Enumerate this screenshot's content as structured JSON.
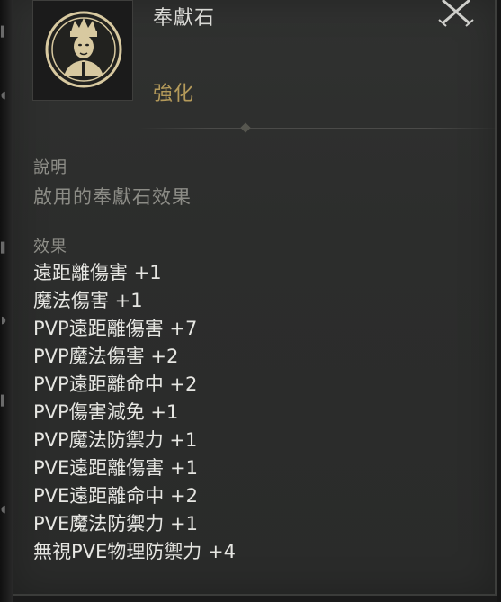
{
  "item": {
    "name": "奉獻石",
    "grade": "強化",
    "icon": "noble-portrait-medallion-icon"
  },
  "close_button": {
    "icon": "crossed-swords-close-icon"
  },
  "description": {
    "header": "說明",
    "text": "啟用的奉獻石效果"
  },
  "effects": {
    "header": "效果",
    "items": [
      "遠距離傷害 +1",
      "魔法傷害 +1",
      "PVP遠距離傷害 +7",
      "PVP魔法傷害 +2",
      "PVP遠距離命中 +2",
      "PVP傷害減免 +1",
      "PVP魔法防禦力 +1",
      "PVE遠距離傷害 +1",
      "PVE遠距離命中 +2",
      "PVE魔法防禦力 +1",
      "無視PVE物理防禦力 +4"
    ]
  },
  "colors": {
    "panel_bg": "#2c2d2c",
    "title": "#d9d9d5",
    "grade": "#b49a5a",
    "section_header": "#8f8f89",
    "effect_text": "#e6e6e2",
    "icon_gold": "#d8c9a0"
  }
}
